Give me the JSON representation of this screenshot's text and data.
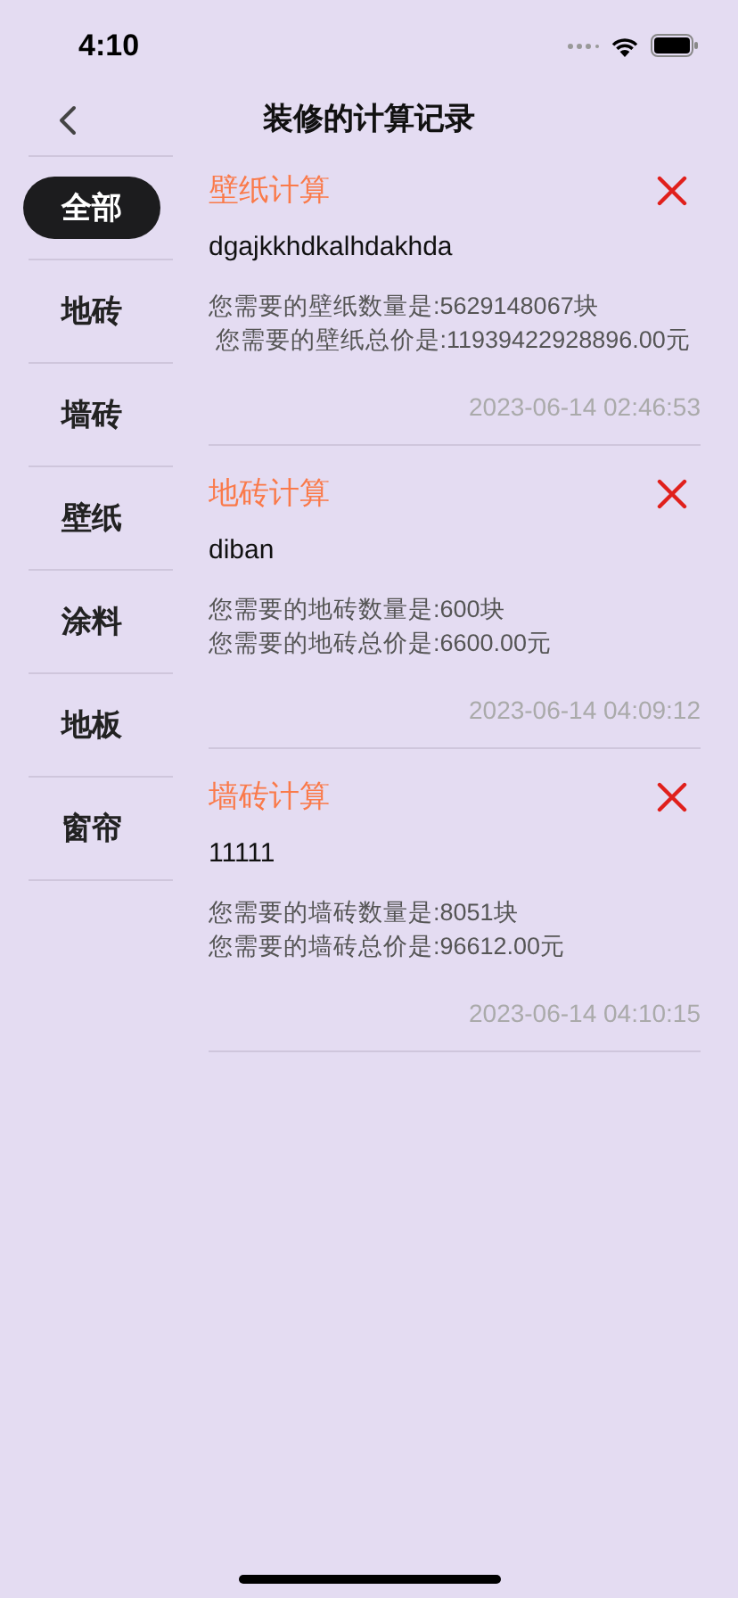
{
  "status_bar": {
    "time": "4:10"
  },
  "nav": {
    "title": "装修的计算记录"
  },
  "sidebar": {
    "items": [
      {
        "label": "全部",
        "selected": true
      },
      {
        "label": "地砖",
        "selected": false
      },
      {
        "label": "墙砖",
        "selected": false
      },
      {
        "label": "壁纸",
        "selected": false
      },
      {
        "label": "涂料",
        "selected": false
      },
      {
        "label": "地板",
        "selected": false
      },
      {
        "label": "窗帘",
        "selected": false
      }
    ]
  },
  "records": [
    {
      "title": "壁纸计算",
      "name": "dgajkkhdkalhdakhda",
      "lines": [
        "您需要的壁纸数量是:5629148067块",
        " 您需要的壁纸总价是:11939422928896.00元"
      ],
      "time": "2023-06-14 02:46:53"
    },
    {
      "title": "地砖计算",
      "name": "diban",
      "lines": [
        "您需要的地砖数量是:600块",
        "您需要的地砖总价是:6600.00元"
      ],
      "time": "2023-06-14 04:09:12"
    },
    {
      "title": "墙砖计算",
      "name": "11111",
      "lines": [
        "您需要的墙砖数量是:8051块",
        "您需要的墙砖总价是:96612.00元"
      ],
      "time": "2023-06-14 04:10:15"
    }
  ]
}
